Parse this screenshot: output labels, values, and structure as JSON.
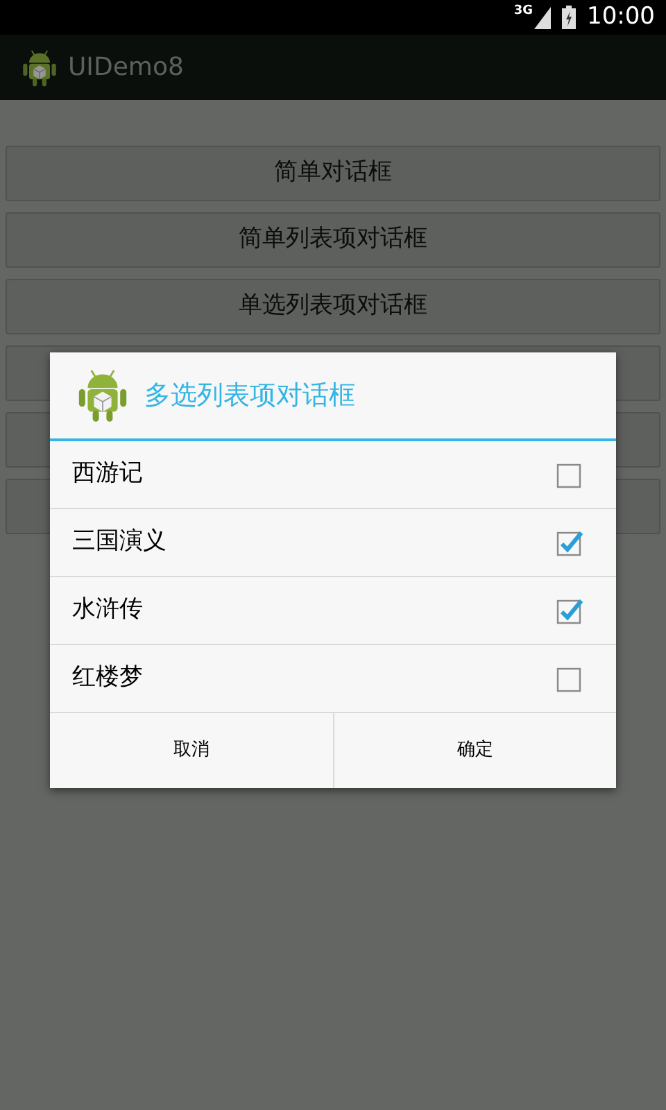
{
  "status_bar": {
    "network": "3G",
    "time": "10:00"
  },
  "action_bar": {
    "title": "UIDemo8"
  },
  "buttons": [
    {
      "kind": "labeled",
      "label": "简单对话框"
    },
    {
      "kind": "labeled",
      "label": "简单列表项对话框"
    },
    {
      "kind": "labeled",
      "label": "单选列表项对话框"
    },
    {
      "kind": "hidden"
    },
    {
      "kind": "hidden"
    },
    {
      "kind": "hidden"
    }
  ],
  "dialog": {
    "title": "多选列表项对话框",
    "items": [
      {
        "label": "西游记",
        "checked": false
      },
      {
        "label": "三国演义",
        "checked": true
      },
      {
        "label": "水浒传",
        "checked": true
      },
      {
        "label": "红楼梦",
        "checked": false
      }
    ],
    "actions": [
      "取消",
      "确定"
    ]
  }
}
